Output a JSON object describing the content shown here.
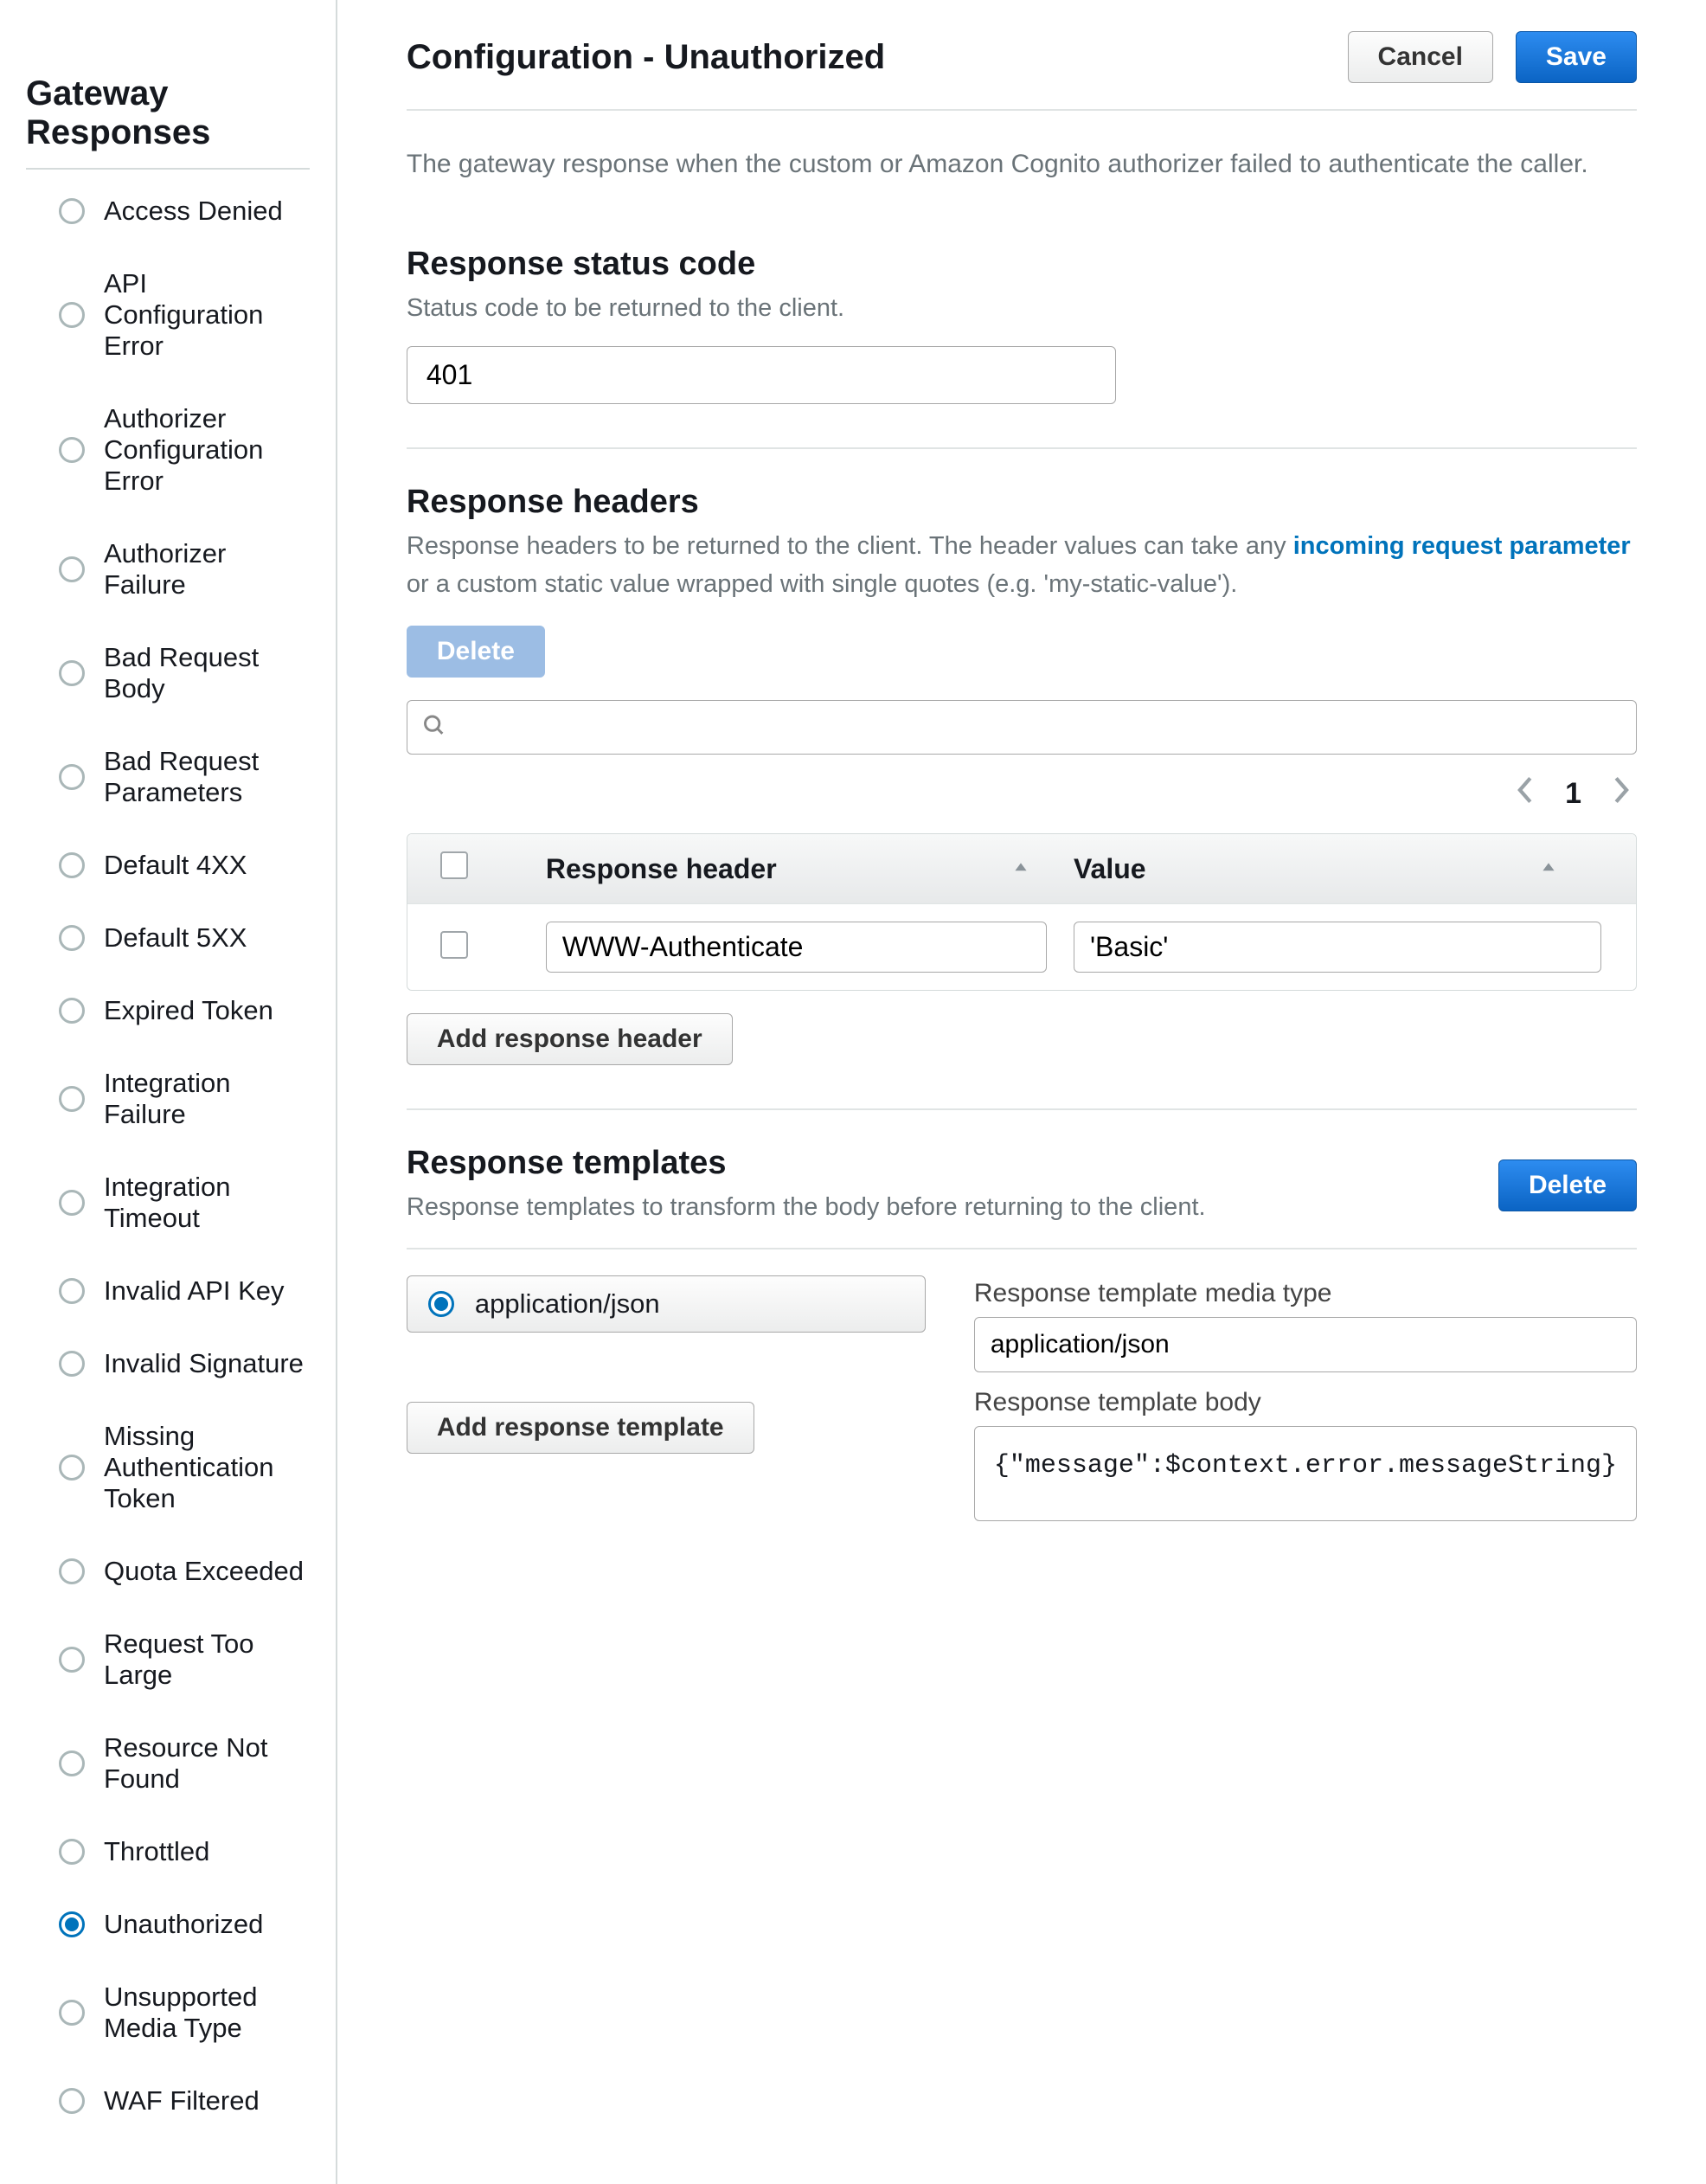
{
  "sidebar": {
    "title": "Gateway Responses",
    "items": [
      {
        "label": "Access Denied",
        "selected": false
      },
      {
        "label": "API Configuration Error",
        "selected": false
      },
      {
        "label": "Authorizer Configuration Error",
        "selected": false
      },
      {
        "label": "Authorizer Failure",
        "selected": false
      },
      {
        "label": "Bad Request Body",
        "selected": false
      },
      {
        "label": "Bad Request Parameters",
        "selected": false
      },
      {
        "label": "Default 4XX",
        "selected": false
      },
      {
        "label": "Default 5XX",
        "selected": false
      },
      {
        "label": "Expired Token",
        "selected": false
      },
      {
        "label": "Integration Failure",
        "selected": false
      },
      {
        "label": "Integration Timeout",
        "selected": false
      },
      {
        "label": "Invalid API Key",
        "selected": false
      },
      {
        "label": "Invalid Signature",
        "selected": false
      },
      {
        "label": "Missing Authentication Token",
        "selected": false
      },
      {
        "label": "Quota Exceeded",
        "selected": false
      },
      {
        "label": "Request Too Large",
        "selected": false
      },
      {
        "label": "Resource Not Found",
        "selected": false
      },
      {
        "label": "Throttled",
        "selected": false
      },
      {
        "label": "Unauthorized",
        "selected": true
      },
      {
        "label": "Unsupported Media Type",
        "selected": false
      },
      {
        "label": "WAF Filtered",
        "selected": false
      }
    ]
  },
  "header": {
    "title": "Configuration - Unauthorized",
    "cancel": "Cancel",
    "save": "Save",
    "description": "The gateway response when the custom or Amazon Cognito authorizer failed to authenticate the caller."
  },
  "statusCode": {
    "title": "Response status code",
    "sub": "Status code to be returned to the client.",
    "value": "401"
  },
  "headers": {
    "title": "Response headers",
    "sub_pre": "Response headers to be returned to the client. The header values can take any ",
    "link": "incoming request parameter",
    "sub_post": " or a custom static value wrapped with single quotes (e.g. 'my-static-value').",
    "delete": "Delete",
    "page_num": "1",
    "col_header": "Response header",
    "col_value": "Value",
    "row_header": "WWW-Authenticate",
    "row_value": "'Basic'",
    "add_btn": "Add response header"
  },
  "templates": {
    "title": "Response templates",
    "sub": "Response templates to transform the body before returning to the client.",
    "delete": "Delete",
    "item_label": "application/json",
    "media_label": "Response template media type",
    "media_value": "application/json",
    "body_label": "Response template body",
    "body_value": "{\"message\":$context.error.messageString}",
    "add_btn": "Add response template"
  }
}
